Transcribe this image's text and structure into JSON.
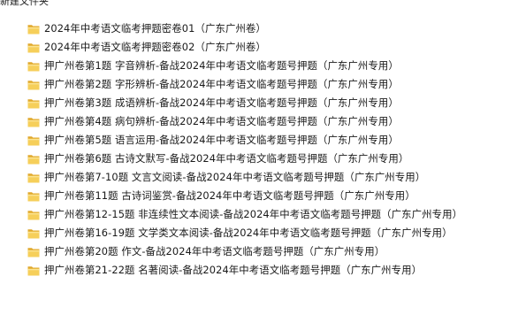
{
  "header": {
    "title": "新建文件夹"
  },
  "items": [
    {
      "label": "2024年中考语文临考押题密卷01（广东广州卷）",
      "icon": "folder-icon"
    },
    {
      "label": "2024年中考语文临考押题密卷02（广东广州卷）",
      "icon": "folder-icon"
    },
    {
      "label": "押广州卷第1题 字音辨析-备战2024年中考语文临考题号押题（广东广州专用）",
      "icon": "folder-icon"
    },
    {
      "label": "押广州卷第2题 字形辨析-备战2024年中考语文临考题号押题（广东广州专用）",
      "icon": "folder-icon"
    },
    {
      "label": "押广州卷第3题 成语辨析-备战2024年中考语文临考题号押题（广东广州专用）",
      "icon": "folder-icon"
    },
    {
      "label": "押广州卷第4题 病句辨析-备战2024年中考语文临考题号押题（广东广州专用）",
      "icon": "folder-icon"
    },
    {
      "label": "押广州卷第5题 语言运用-备战2024年中考语文临考题号押题（广东广州专用）",
      "icon": "folder-icon"
    },
    {
      "label": "押广州卷第6题 古诗文默写-备战2024年中考语文临考题号押题（广东广州专用）",
      "icon": "folder-icon"
    },
    {
      "label": "押广州卷第7-10题 文言文阅读-备战2024年中考语文临考题号押题（广东广州专用）",
      "icon": "folder-icon"
    },
    {
      "label": "押广州卷第11题 古诗词鉴赏-备战2024年中考语文临考题号押题（广东广州专用）",
      "icon": "folder-icon"
    },
    {
      "label": "押广州卷第12-15题 非连续性文本阅读-备战2024年中考语文临考题号押题（广东广州专用）",
      "icon": "folder-icon"
    },
    {
      "label": "押广州卷第16-19题 文学类文本阅读-备战2024年中考语文临考题号押题（广东广州专用）",
      "icon": "folder-icon"
    },
    {
      "label": "押广州卷第20题 作文-备战2024年中考语文临考题号押题（广东广州专用）",
      "icon": "folder-icon"
    },
    {
      "label": "押广州卷第21-22题 名著阅读-备战2024年中考语文临考题号押题（广东广州专用）",
      "icon": "folder-icon"
    }
  ],
  "colors": {
    "folder_back": "#e0a82e",
    "folder_front": "#f6cf5a",
    "folder_highlight": "#fbe59a",
    "text": "#1a1a1a",
    "background": "#ffffff"
  }
}
